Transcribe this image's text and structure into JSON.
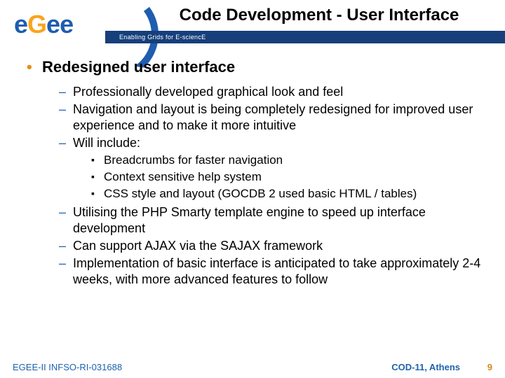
{
  "header": {
    "title": "Code Development - User Interface",
    "subtitle": "Enabling Grids for E-sciencE"
  },
  "logo": {
    "text_e1": "e",
    "text_g": "G",
    "text_e2": "e",
    "text_e3": "e"
  },
  "body": {
    "bullet1": "Redesigned user interface",
    "l2": {
      "a": "Professionally developed graphical look and feel",
      "b": "Navigation and layout is being completely redesigned for improved user experience and to make it more intuitive",
      "c": "Will include:",
      "d": "Utilising the PHP Smarty template engine to speed up interface development",
      "e": "Can support AJAX via the SAJAX framework",
      "f": "Implementation of basic interface is anticipated to take approximately 2-4 weeks, with more advanced features to follow"
    },
    "l3": {
      "a": "Breadcrumbs for faster navigation",
      "b": "Context sensitive help system",
      "c": "CSS style and layout (GOCDB 2 used basic HTML / tables)"
    }
  },
  "footer": {
    "left": "EGEE-II INFSO-RI-031688",
    "right": "COD-11, Athens",
    "page": "9"
  }
}
